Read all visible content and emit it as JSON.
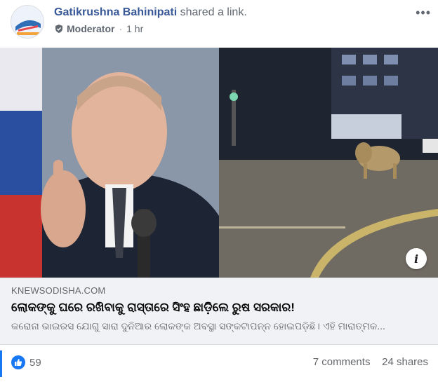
{
  "header": {
    "author": "Gatikrushna Bahinipati",
    "action": "shared a link.",
    "role": "Moderator",
    "separator": "·",
    "time": "1 hr",
    "more": "•••"
  },
  "link": {
    "domain": "KNEWSODISHA.COM",
    "title": "ଲୋକଙ୍କୁ ଘରେ ରଖିବାକୁ ରାସ୍ତାରେ ସିଂହ ଛାଡ଼ିଲେ ରୁଷ ସରକାର!",
    "description": "କରୋନା ଭାଇରସ ଯୋଗୁ ସାରା ଦୁନିଆର ଲୋକଙ୍କ ଅବସ୍ଥା ସଙ୍କଟାପନ୍ନ ହୋଇପଡ଼ିଛି। ଏହି ମାରାତ୍ମକ...",
    "info_glyph": "i"
  },
  "footer": {
    "reactions_count": "59",
    "comments": "7 comments",
    "shares": "24 shares"
  },
  "colors": {
    "author": "#385898",
    "like": "#1877f2",
    "muted": "#65676b"
  }
}
